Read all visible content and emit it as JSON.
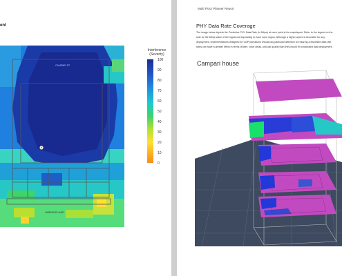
{
  "left_page": {
    "title_fragment": "ent",
    "heatmap_labels": {
      "top_street": "CAMPARI ST",
      "bottom_street": "HARBOUR LANE",
      "ap_marker": "P"
    },
    "legend": {
      "title_line1": "Interference",
      "title_line2": "(Severity)",
      "ticks": [
        "100",
        "90",
        "80",
        "70",
        "60",
        "50",
        "40",
        "30",
        "20",
        "10",
        "0"
      ],
      "colors": [
        "#1a2e8f",
        "#1f55c8",
        "#1e8fe0",
        "#1bc9d0",
        "#3fd36b",
        "#b9e030",
        "#ffe033",
        "#f58e1e"
      ]
    }
  },
  "right_page": {
    "header": "Multi Floor Planner Report",
    "section_title": "PHY Data Rate Coverage",
    "body_lines": [
      "The image below depicts the Predictive PHY Data Rate (in Mbps) at each point in the map/layout. Refer to the legend on the",
      "side for the Mbps value of the signal corresponding to each color region. Although a higher speed is favorable for any",
      "deployment, implementations designed for VoIP operations should pay particular attention to ensuring a favorable data rate",
      "rates can have a greater effect in terms of jitter, voice delay, and call quality than they would for a standard data deployment."
    ],
    "floor_title": "Campari house",
    "viewer": {
      "background": "#ffffff",
      "ground_color": "#3d4a5f",
      "slab_color": "#c24ac0"
    }
  }
}
